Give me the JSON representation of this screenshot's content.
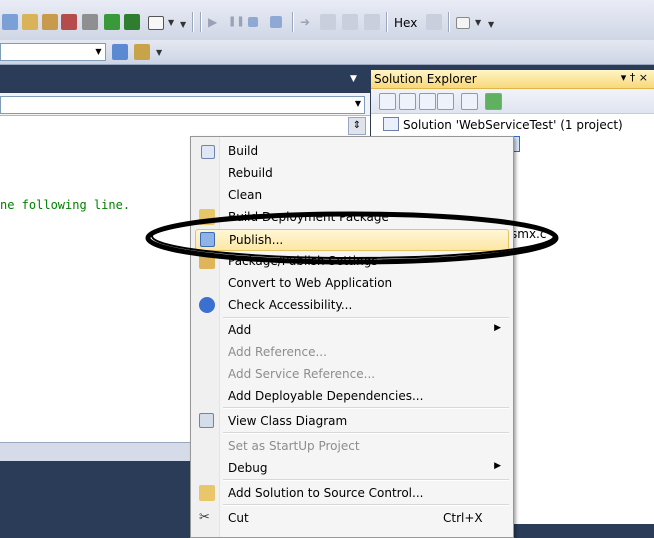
{
  "toolbar": {
    "hex_label": "Hex"
  },
  "editor": {
    "code_text": "ne following line."
  },
  "solution_explorer": {
    "title": "Solution Explorer",
    "title_buttons": "▾ † ×",
    "root_label": "Solution 'WebServiceTest' (1 project)",
    "partial_item": "smx.c"
  },
  "context_menu": {
    "items": [
      {
        "label": "Build"
      },
      {
        "label": "Rebuild"
      },
      {
        "label": "Clean"
      },
      {
        "label": "Build Deployment Package"
      },
      {
        "label": "Publish..."
      },
      {
        "label": "Package/Publish Settings"
      },
      {
        "label": "Convert to Web Application"
      },
      {
        "label": "Check Accessibility..."
      },
      {
        "label": "Add"
      },
      {
        "label": "Add Reference..."
      },
      {
        "label": "Add Service Reference..."
      },
      {
        "label": "Add Deployable Dependencies..."
      },
      {
        "label": "View Class Diagram"
      },
      {
        "label": "Set as StartUp Project"
      },
      {
        "label": "Debug"
      },
      {
        "label": "Add Solution to Source Control..."
      },
      {
        "label": "Cut",
        "shortcut": "Ctrl+X"
      }
    ]
  },
  "colors": {
    "highlight": "#fde7a4",
    "annotation": "#000000",
    "code_comment": "#008000"
  }
}
